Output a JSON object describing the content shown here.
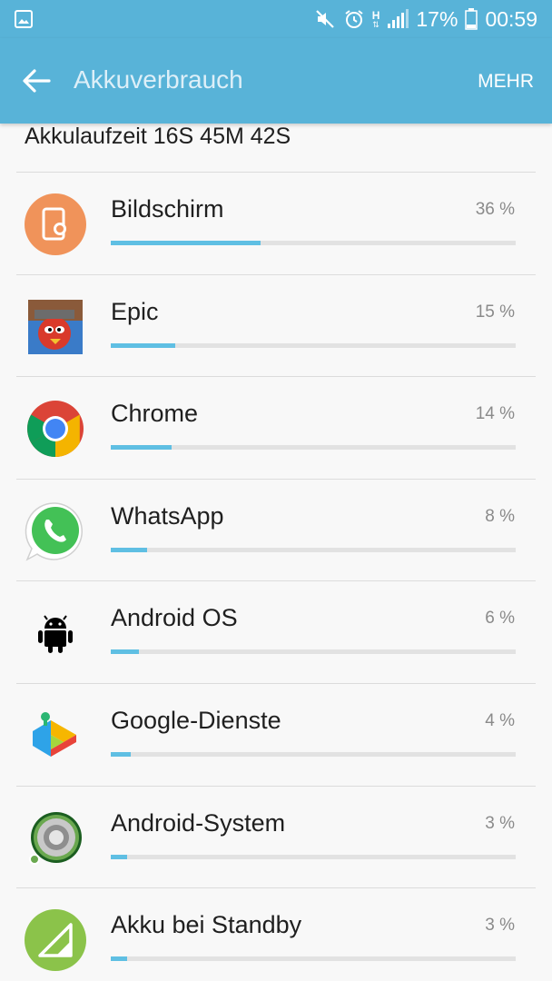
{
  "status_bar": {
    "icons": [
      "gallery-notification-icon",
      "mute-icon",
      "alarm-icon",
      "h-network-icon",
      "signal-icon",
      "battery-icon"
    ],
    "network_label": "H",
    "battery": "17%",
    "time": "00:59"
  },
  "header": {
    "title": "Akkuverbrauch",
    "more_label": "MEHR",
    "background_color": "#58b3d8"
  },
  "summary": "Akkulaufzeit 16S 45M 42S",
  "apps": [
    {
      "name": "Bildschirm",
      "percent": "36 %",
      "fraction": 0.37,
      "icon": "screen-brightness-icon"
    },
    {
      "name": "Epic",
      "percent": "15 %",
      "fraction": 0.16,
      "icon": "epic-game-icon"
    },
    {
      "name": "Chrome",
      "percent": "14 %",
      "fraction": 0.15,
      "icon": "chrome-icon"
    },
    {
      "name": "WhatsApp",
      "percent": "8 %",
      "fraction": 0.09,
      "icon": "whatsapp-icon"
    },
    {
      "name": "Android OS",
      "percent": "6 %",
      "fraction": 0.07,
      "icon": "android-icon"
    },
    {
      "name": "Google-Dienste",
      "percent": "4 %",
      "fraction": 0.05,
      "icon": "google-play-services-icon"
    },
    {
      "name": "Android-System",
      "percent": "3 %",
      "fraction": 0.04,
      "icon": "android-system-icon"
    },
    {
      "name": "Akku bei Standby",
      "percent": "3 %",
      "fraction": 0.04,
      "icon": "standby-signal-icon"
    }
  ]
}
